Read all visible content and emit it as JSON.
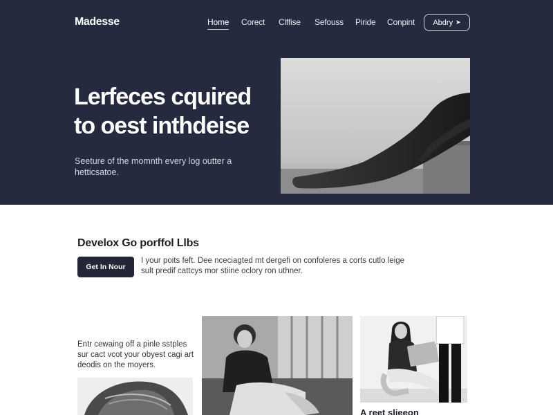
{
  "brand": {
    "logo": "Madesse"
  },
  "nav": {
    "items": [
      "Home",
      "Corect",
      "Clffise",
      "Sefouss",
      "Piride",
      "Conpint"
    ],
    "active": "Home",
    "cta_label": "Abdry",
    "cta_icon": "arrow-right-icon"
  },
  "hero": {
    "title": "Lerfeces cquired to oest inthdeise",
    "subtitle": "Seeture of the momnth every log outter a hetticsatoe."
  },
  "section": {
    "heading": "Develox Go porffol Llbs",
    "button_label": "Get In Nour",
    "description": "I your poits feft. Dee nceciagted mt dergefi on confoleres a corts cutlo leige sult predif cattcys mor stiine oclory ron uthner."
  },
  "cards": {
    "left_text": "Entr cewaing off a pinle sstples sur cact vcot your obyest cagi art deodis on the moyers.",
    "right_caption": "A reet slieeon"
  },
  "colors": {
    "hero_bg": "#262a3e",
    "button_bg": "#222637",
    "text_dark": "#1d1f29"
  }
}
